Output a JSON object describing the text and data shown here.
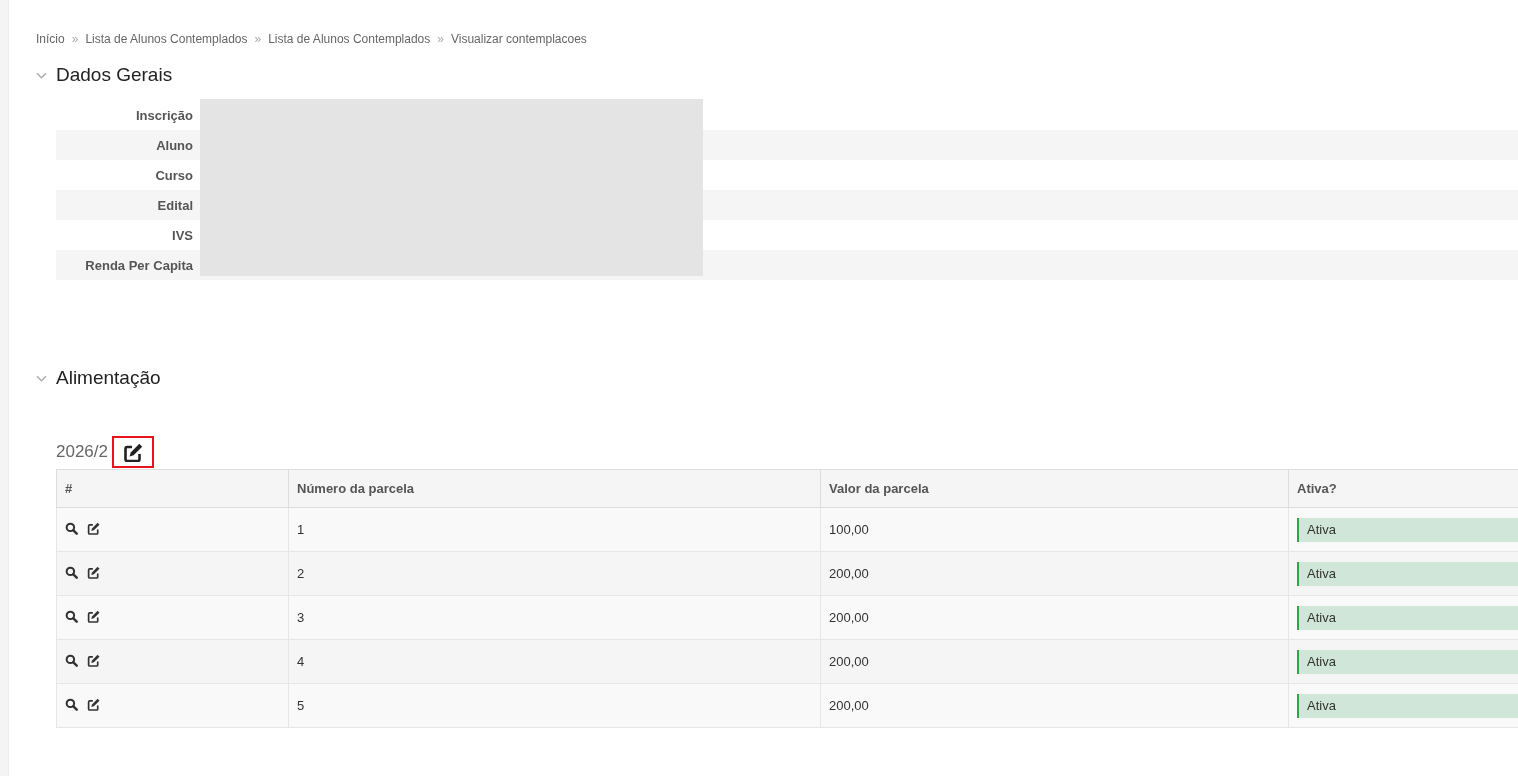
{
  "breadcrumb": [
    {
      "label": "Início"
    },
    {
      "separator": "»",
      "label": "Lista de Alunos Contemplados"
    },
    {
      "separator": "»",
      "label": "Lista de Alunos Contemplados"
    },
    {
      "separator": "»",
      "label": "Visualizar contemplacoes"
    }
  ],
  "dados_gerais": {
    "title": "Dados Gerais",
    "expanded": true,
    "values_redacted": true,
    "fields": [
      {
        "label": "Inscrição"
      },
      {
        "label": "Aluno"
      },
      {
        "label": "Curso"
      },
      {
        "label": "Edital"
      },
      {
        "label": "IVS"
      },
      {
        "label": "Renda Per Capita"
      }
    ]
  },
  "alimentacao": {
    "title": "Alimentação",
    "expanded": true,
    "periods": [
      {
        "title": "2026/2",
        "edit_highlighted": true,
        "table": {
          "columns": [
            "#",
            "Número da parcela",
            "Valor da parcela",
            "Ativa?"
          ],
          "rows": [
            {
              "numero": "1",
              "valor": "100,00",
              "status": "Ativa",
              "active": true
            },
            {
              "numero": "2",
              "valor": "200,00",
              "status": "Ativa",
              "active": true
            },
            {
              "numero": "3",
              "valor": "200,00",
              "status": "Ativa",
              "active": true
            },
            {
              "numero": "4",
              "valor": "200,00",
              "status": "Ativa",
              "active": true
            },
            {
              "numero": "5",
              "valor": "200,00",
              "status": "Ativa",
              "active": true
            }
          ]
        }
      }
    ]
  }
}
